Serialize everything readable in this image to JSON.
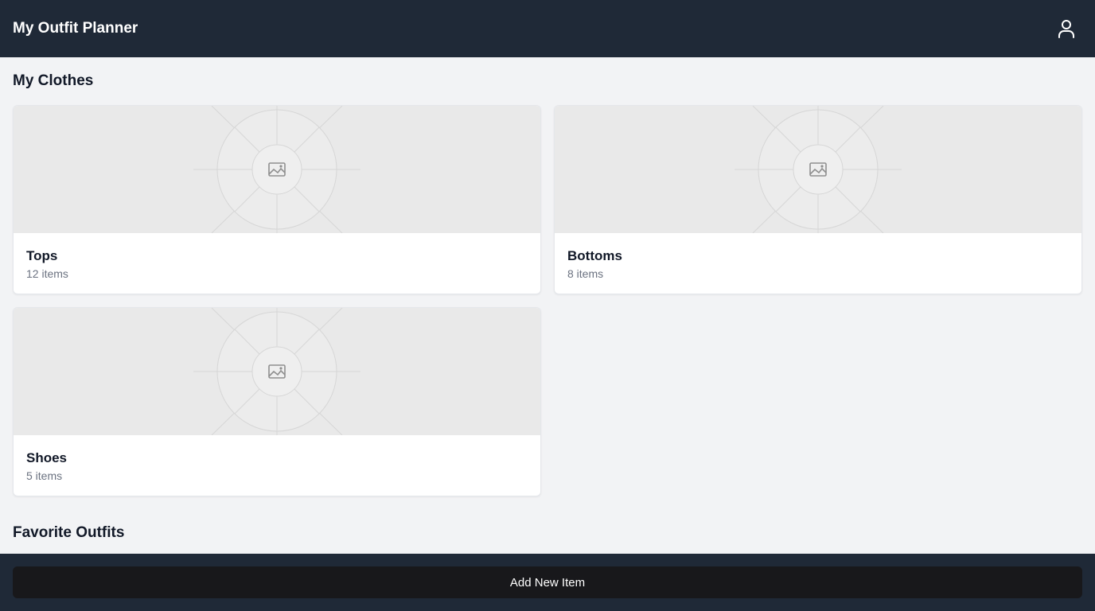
{
  "header": {
    "title": "My Outfit Planner",
    "profile_icon": "user-icon"
  },
  "clothes": {
    "title": "My Clothes",
    "categories": [
      {
        "name": "Tops",
        "count": "12 items",
        "image_icon": "image-placeholder-icon"
      },
      {
        "name": "Bottoms",
        "count": "8 items",
        "image_icon": "image-placeholder-icon"
      },
      {
        "name": "Shoes",
        "count": "5 items",
        "image_icon": "image-placeholder-icon"
      }
    ]
  },
  "favorites": {
    "title": "Favorite Outfits"
  },
  "footer": {
    "add_label": "Add New Item"
  },
  "colors": {
    "header_bg": "#1f2937",
    "page_bg": "#f2f3f5",
    "button_bg": "#18181b",
    "muted_text": "#6b7280"
  }
}
